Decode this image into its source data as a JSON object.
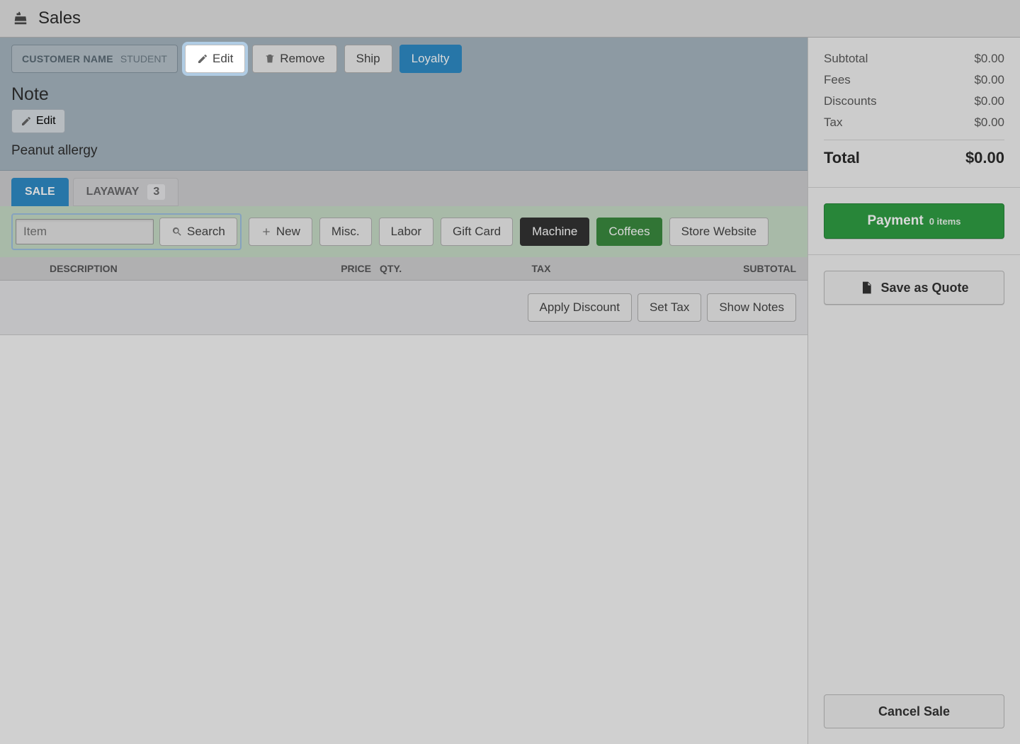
{
  "header": {
    "title": "Sales"
  },
  "customer": {
    "label": "CUSTOMER NAME",
    "value": "STUDENT",
    "edit": "Edit",
    "remove": "Remove",
    "ship": "Ship",
    "loyalty": "Loyalty"
  },
  "note": {
    "heading": "Note",
    "edit": "Edit",
    "text": "Peanut allergy"
  },
  "tabs": {
    "sale": "SALE",
    "layaway": "LAYAWAY",
    "layaway_count": "3"
  },
  "itemBar": {
    "placeholder": "Item",
    "search": "Search",
    "new": "New",
    "misc": "Misc.",
    "labor": "Labor",
    "giftcard": "Gift Card",
    "machine": "Machine",
    "coffees": "Coffees",
    "store": "Store Website"
  },
  "columns": {
    "description": "DESCRIPTION",
    "price": "PRICE",
    "qty": "QTY.",
    "tax": "TAX",
    "subtotal": "SUBTOTAL"
  },
  "actions": {
    "apply_discount": "Apply Discount",
    "set_tax": "Set Tax",
    "show_notes": "Show Notes"
  },
  "totals": {
    "subtotal_label": "Subtotal",
    "subtotal_value": "$0.00",
    "fees_label": "Fees",
    "fees_value": "$0.00",
    "discounts_label": "Discounts",
    "discounts_value": "$0.00",
    "tax_label": "Tax",
    "tax_value": "$0.00",
    "total_label": "Total",
    "total_value": "$0.00"
  },
  "sidebar": {
    "payment": "Payment",
    "payment_sub": "0 items",
    "save_quote": "Save as Quote",
    "cancel_sale": "Cancel Sale"
  }
}
